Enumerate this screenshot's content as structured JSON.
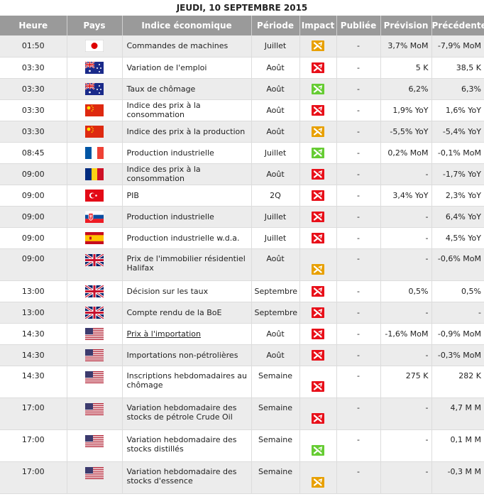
{
  "title": "JEUDI, 10 SEPTEMBRE 2015",
  "headers": [
    "Heure",
    "Pays",
    "Indice économique",
    "Période",
    "Impact",
    "Publiée",
    "Prévision",
    "Précédente"
  ],
  "impact_colors": {
    "low": "#66cc33",
    "medium": "#e8a000",
    "high": "#e8101a"
  },
  "rows": [
    {
      "time": "01:50",
      "country": "jp",
      "indicator": "Commandes de machines",
      "period": "Juillet",
      "impact": "medium",
      "published": "-",
      "forecast": "3,7% MoM",
      "previous": "-7,9% MoM"
    },
    {
      "time": "03:30",
      "country": "au",
      "indicator": "Variation de l'emploi",
      "period": "Août",
      "impact": "high",
      "published": "-",
      "forecast": "5 K",
      "previous": "38,5 K"
    },
    {
      "time": "03:30",
      "country": "au",
      "indicator": "Taux de chômage",
      "period": "Août",
      "impact": "low",
      "published": "-",
      "forecast": "6,2%",
      "previous": "6,3%"
    },
    {
      "time": "03:30",
      "country": "cn",
      "indicator": "Indice des prix à la consommation",
      "period": "Août",
      "impact": "high",
      "published": "-",
      "forecast": "1,9% YoY",
      "previous": "1,6% YoY"
    },
    {
      "time": "03:30",
      "country": "cn",
      "indicator": "Indice des prix à la production",
      "period": "Août",
      "impact": "medium",
      "published": "-",
      "forecast": "-5,5% YoY",
      "previous": "-5,4% YoY"
    },
    {
      "time": "08:45",
      "country": "fr",
      "indicator": "Production industrielle",
      "period": "Juillet",
      "impact": "low",
      "published": "-",
      "forecast": "0,2% MoM",
      "previous": "-0,1% MoM"
    },
    {
      "time": "09:00",
      "country": "ro",
      "indicator": "Indice des prix à la consommation",
      "period": "Août",
      "impact": "high",
      "published": "-",
      "forecast": "-",
      "previous": "-1,7% YoY"
    },
    {
      "time": "09:00",
      "country": "tr",
      "indicator": "PIB",
      "period": "2Q",
      "impact": "high",
      "published": "-",
      "forecast": "3,4% YoY",
      "previous": "2,3% YoY"
    },
    {
      "time": "09:00",
      "country": "sk",
      "indicator": "Production industrielle",
      "period": "Juillet",
      "impact": "high",
      "published": "-",
      "forecast": "-",
      "previous": "6,4% YoY"
    },
    {
      "time": "09:00",
      "country": "es",
      "indicator": "Production industrielle w.d.a.",
      "period": "Juillet",
      "impact": "high",
      "published": "-",
      "forecast": "-",
      "previous": "4,5% YoY"
    },
    {
      "time": "09:00",
      "country": "gb",
      "indicator": "Prix de l'immobilier résidentiel Halifax",
      "period": "Août",
      "impact": "medium",
      "published": "-",
      "forecast": "-",
      "previous": "-0,6% MoM",
      "tall": true
    },
    {
      "time": "13:00",
      "country": "gb",
      "indicator": "Décision sur les taux",
      "period": "Septembre",
      "impact": "high",
      "published": "-",
      "forecast": "0,5%",
      "previous": "0,5%"
    },
    {
      "time": "13:00",
      "country": "gb",
      "indicator": "Compte rendu de la BoE",
      "period": "Septembre",
      "impact": "high",
      "published": "-",
      "forecast": "-",
      "previous": "-"
    },
    {
      "time": "14:30",
      "country": "us",
      "indicator": "Prix à l'importation",
      "period": "Août",
      "impact": "high",
      "published": "-",
      "forecast": "-1,6% MoM",
      "previous": "-0,9% MoM",
      "link": true
    },
    {
      "time": "14:30",
      "country": "us",
      "indicator": "Importations non-pétrolières",
      "period": "Août",
      "impact": "high",
      "published": "-",
      "forecast": "-",
      "previous": "-0,3% MoM"
    },
    {
      "time": "14:30",
      "country": "us",
      "indicator": "Inscriptions hebdomadaires au chômage",
      "period": "Semaine",
      "impact": "high",
      "published": "-",
      "forecast": "275 K",
      "previous": "282 K",
      "tall": true
    },
    {
      "time": "17:00",
      "country": "us",
      "indicator": "Variation hebdomadaire des stocks de pétrole Crude Oil",
      "period": "Semaine",
      "impact": "high",
      "published": "-",
      "forecast": "-",
      "previous": "4,7 M M",
      "tall": true
    },
    {
      "time": "17:00",
      "country": "us",
      "indicator": "Variation hebdomadaire des stocks distillés",
      "period": "Semaine",
      "impact": "low",
      "published": "-",
      "forecast": "-",
      "previous": "0,1 M M",
      "tall": true
    },
    {
      "time": "17:00",
      "country": "us",
      "indicator": "Variation hebdomadaire des stocks d'essence",
      "period": "Semaine",
      "impact": "medium",
      "published": "-",
      "forecast": "-",
      "previous": "-0,3 M M",
      "tall": true
    }
  ]
}
